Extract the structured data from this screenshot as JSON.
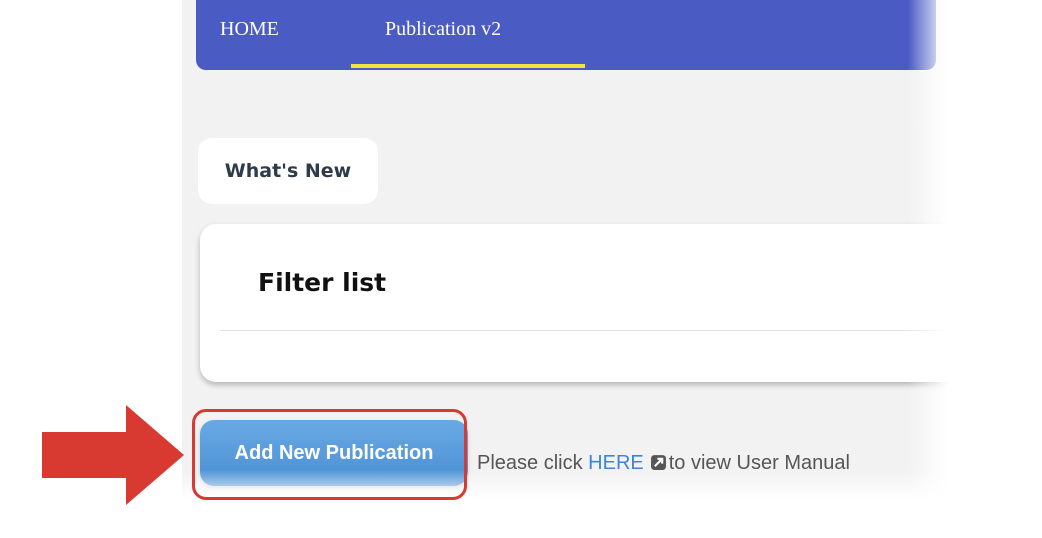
{
  "navbar": {
    "items": [
      {
        "label": "HOME"
      },
      {
        "label": "Publication v2",
        "active": true
      }
    ],
    "background_color": "#4a5bc4",
    "active_indicator_color": "#f0e63c"
  },
  "whats_new": {
    "label": "What's New"
  },
  "filter": {
    "title": "Filter list"
  },
  "actions": {
    "add_button_label": "Add New Publication",
    "button_color": "#4a8fd4"
  },
  "manual": {
    "prefix": "Please click ",
    "link_text": "HERE",
    "icon": "external-link-icon",
    "suffix": "to view User Manual"
  },
  "annotation": {
    "color": "#d83a32",
    "arrow_icon": "red-arrow-right-icon"
  }
}
